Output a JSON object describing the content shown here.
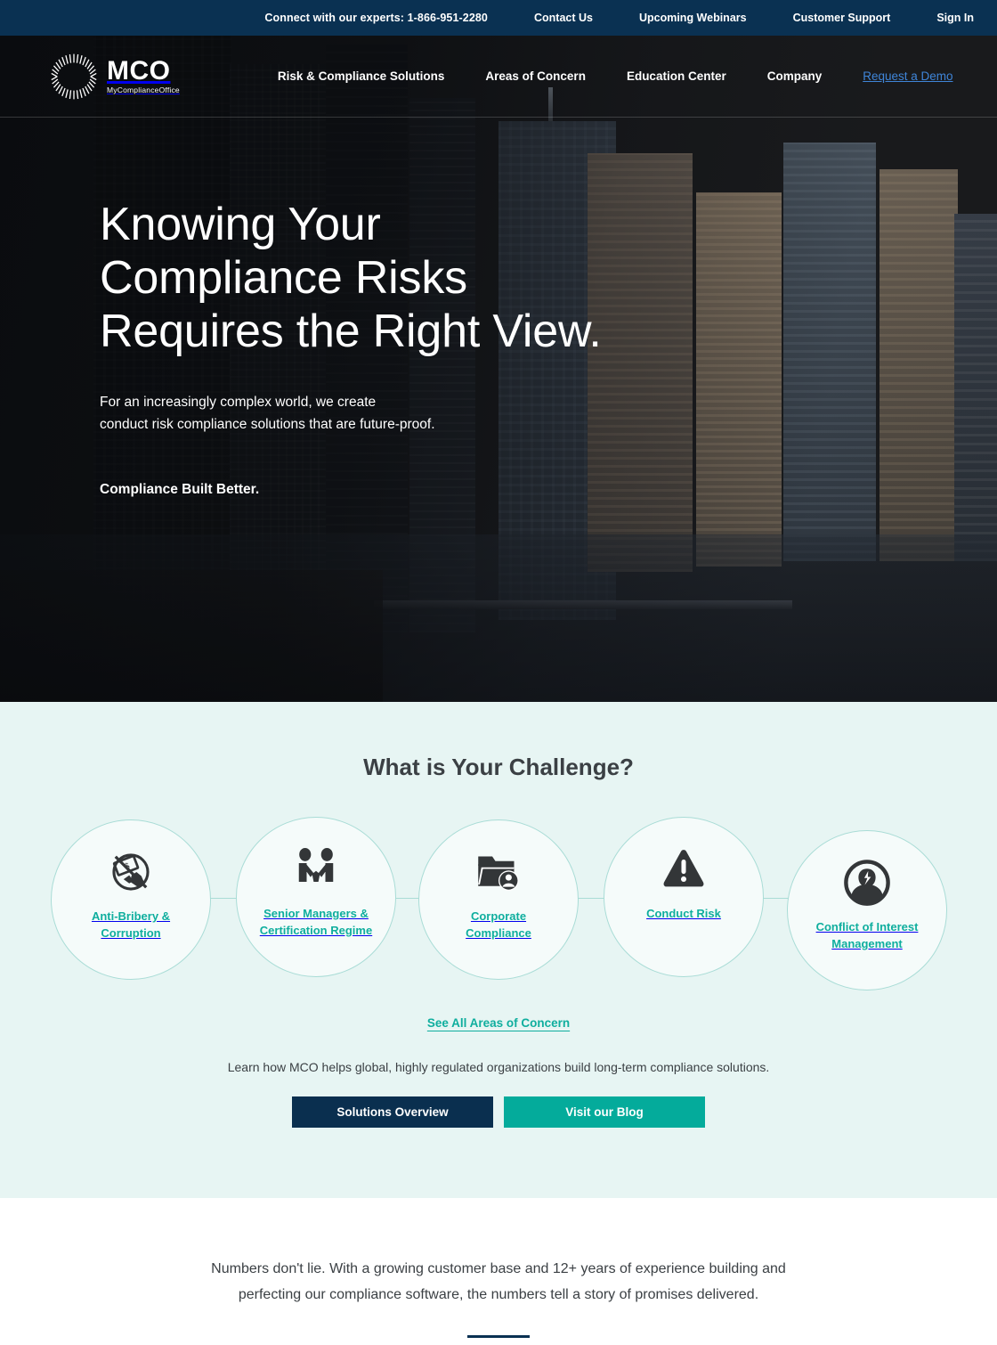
{
  "colors": {
    "navy": "#0a3152",
    "teal": "#0fae9e",
    "teal_button": "#04ab9b",
    "mint_bg": "#e7f5f3",
    "circle_border": "#a9dcd6",
    "demo_link_blue": "#3f85d8",
    "dark_text": "#3b4044"
  },
  "topbar": {
    "phone_text": "Connect with our experts: 1-866-951-2280",
    "links": [
      {
        "label": "Contact Us"
      },
      {
        "label": "Upcoming Webinars"
      },
      {
        "label": "Customer Support"
      },
      {
        "label": "Sign In"
      }
    ]
  },
  "nav": {
    "logo": {
      "mark_icon": "radial-sunburst-icon",
      "wordmark": "MCO",
      "tagline": "MyComplianceOffice"
    },
    "items": [
      {
        "label": "Risk & Compliance Solutions"
      },
      {
        "label": "Areas of Concern"
      },
      {
        "label": "Education Center"
      },
      {
        "label": "Company"
      }
    ],
    "demo_label": "Request a Demo"
  },
  "hero": {
    "heading": "Knowing Your\nCompliance Risks\nRequires the Right View.",
    "subheading": "For an increasingly complex world, we create\nconduct risk compliance solutions that are future-proof.",
    "tagline": "Compliance Built Better."
  },
  "challenge": {
    "heading": "What is Your Challenge?",
    "circles": [
      {
        "label": "Anti-Bribery &\nCorruption",
        "icon": "no-bribery-hand-money-icon"
      },
      {
        "label": "Senior Managers &\nCertification Regime",
        "icon": "handshake-people-icon"
      },
      {
        "label": "Corporate\nCompliance",
        "icon": "folder-person-icon"
      },
      {
        "label": "Conduct Risk",
        "icon": "warning-triangle-icon"
      },
      {
        "label": "Conflict of Interest\nManagement",
        "icon": "person-lightning-circle-icon"
      }
    ],
    "see_all_label": "See All Areas of Concern",
    "learn_line": "Learn how MCO helps global, highly regulated organizations build long-term compliance solutions.",
    "buttons": [
      {
        "label": "Solutions Overview",
        "style": "dark"
      },
      {
        "label": "Visit our Blog",
        "style": "teal"
      }
    ]
  },
  "numbers": {
    "intro": "Numbers don't lie. With a growing customer base and 12+ years of experience building and\nperfecting our compliance software, the numbers tell a story of promises delivered."
  }
}
